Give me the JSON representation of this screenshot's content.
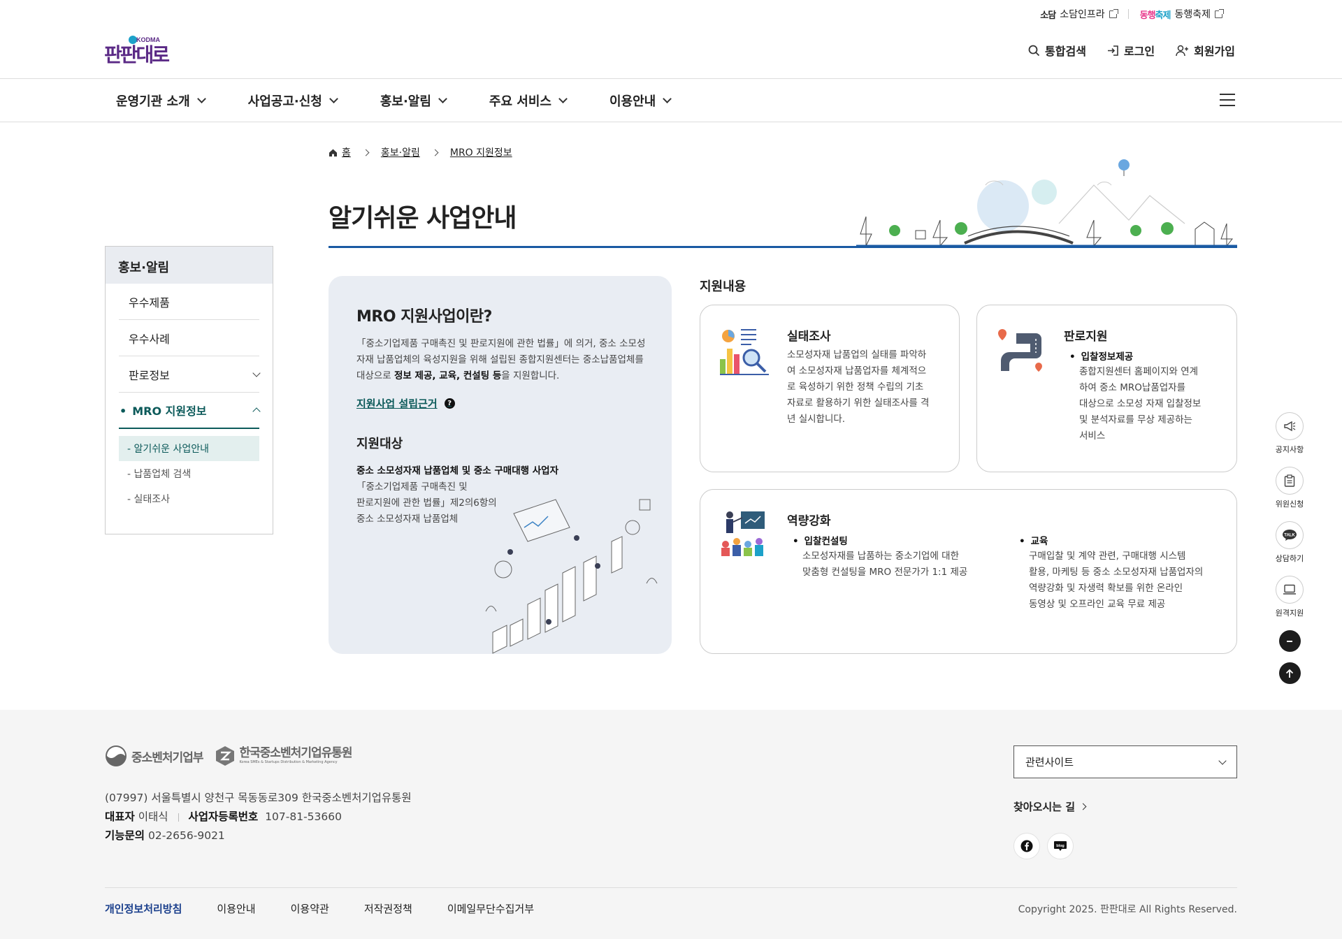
{
  "util": {
    "sodam_logo": "소담",
    "sodam_label": "소담인프라",
    "dh_logo_a": "동행",
    "dh_logo_b": "축제",
    "dh_label": "동행축제"
  },
  "brand": {
    "logo_text": "판판대로",
    "logo_badge": "KODMA"
  },
  "user_links": {
    "search": "통합검색",
    "login": "로그인",
    "signup": "회원가입"
  },
  "gnb": [
    "운영기관 소개",
    "사업공고·신청",
    "홍보·알림",
    "주요 서비스",
    "이용안내"
  ],
  "lnb": {
    "title": "홍보·알림",
    "items": [
      "우수제품",
      "우수사례",
      "판로정보",
      "MRO 지원정보"
    ],
    "sub": [
      "- 알기쉬운 사업안내",
      "- 납품업체 검색",
      "- 실태조사"
    ]
  },
  "breadcrumb": {
    "home": "홈",
    "level1": "홍보·알림",
    "level2": "MRO 지원정보"
  },
  "page_title": "알기쉬운 사업안내",
  "intro": {
    "heading": "MRO 지원사업이란?",
    "desc_1": "「중소기업제품 구매촉진 및 판로지원에 관한 법률」에 의거, 중소 소모성자재 납품업체의 육성지원을 위해 설립된 종합지원센터는 중소납품업체를 대상으로 ",
    "desc_bold": "정보 제공, 교육, 컨설팅 등",
    "desc_2": "을 지원합니다.",
    "basis_link": "지원사업 설립근거",
    "basis_icon": "?",
    "target_heading": "지원대상",
    "target_bold": "중소 소모성자재 납품업체 및 중소 구매대행 사업자",
    "target_l1": "「중소기업제품 구매촉진 및",
    "target_l2": "판로지원에 관한 법률」제2의6항의",
    "target_l3": "중소 소모성자재 납품업체"
  },
  "support": {
    "title": "지원내용",
    "survey": {
      "title": "실태조사",
      "l1": "소모성자재 납품업의 실태를 파악하",
      "l2": "여 소모성자재 납품업자를 체계적으",
      "l3": "로 육성하기 위한 정책 수립의 기초",
      "l4": "자료로 활용하기 위한 실태조사를 격",
      "l5": "년 실시합니다."
    },
    "sales": {
      "title": "판로지원",
      "bullet": "입찰정보제공",
      "l1": "종합지원센터 홈페이지와 연계",
      "l2": "하여 중소 MRO납품업자를",
      "l3": "대상으로 소모성 자재 입찰정보",
      "l4": "및 분석자료를 무상 제공하는",
      "l5": "서비스"
    },
    "capacity": {
      "title": "역량강화",
      "b1": "입찰컨설팅",
      "b1_l1": "소모성자재를 납품하는 중소기업에 대한",
      "b1_l2": "맞춤형 컨설팅을 MRO 전문가가 1:1 제공",
      "b2": "교육",
      "b2_l1": "구매입찰 및 계약 관련, 구매대행 시스템",
      "b2_l2": "활용, 마케팅 등 중소 소모성자재 납품업자의",
      "b2_l3": "역량강화 및 자생력 확보를 위한 온라인",
      "b2_l4": "동영상 및 오프라인 교육 무료 제공"
    }
  },
  "quick": [
    "공지사항",
    "위원신청",
    "상담하기",
    "원격지원"
  ],
  "quick_talk": "TALK",
  "footer": {
    "logo1": "중소벤처기업부",
    "logo2": "한국중소벤처기업유통원",
    "logo2_sub": "Korea SMEs & Startups Distribution & Marketing Agency",
    "address": "(07997) 서울특별시 양천구 목동동로309 한국중소벤처기업유통원",
    "rep_label": "대표자",
    "rep_value": "이태식",
    "biz_label": "사업자등록번호",
    "biz_value": "107-81-53660",
    "tel_label": "기능문의",
    "tel_value": "02-2656-9021",
    "related": "관련사이트",
    "directions": "찾아오시는 길",
    "blog": "blog",
    "links": [
      "개인정보처리방침",
      "이용안내",
      "이용약관",
      "저작권정책",
      "이메일무단수집거부"
    ],
    "copyright": "Copyright 2025. 판판대로 All Rights Reserved."
  },
  "colors": {
    "accent": "#0c5a5a",
    "title_line": "#1a5aa3",
    "brand_purple": "#5b2a86",
    "footer_link": "#1a3f8c"
  }
}
